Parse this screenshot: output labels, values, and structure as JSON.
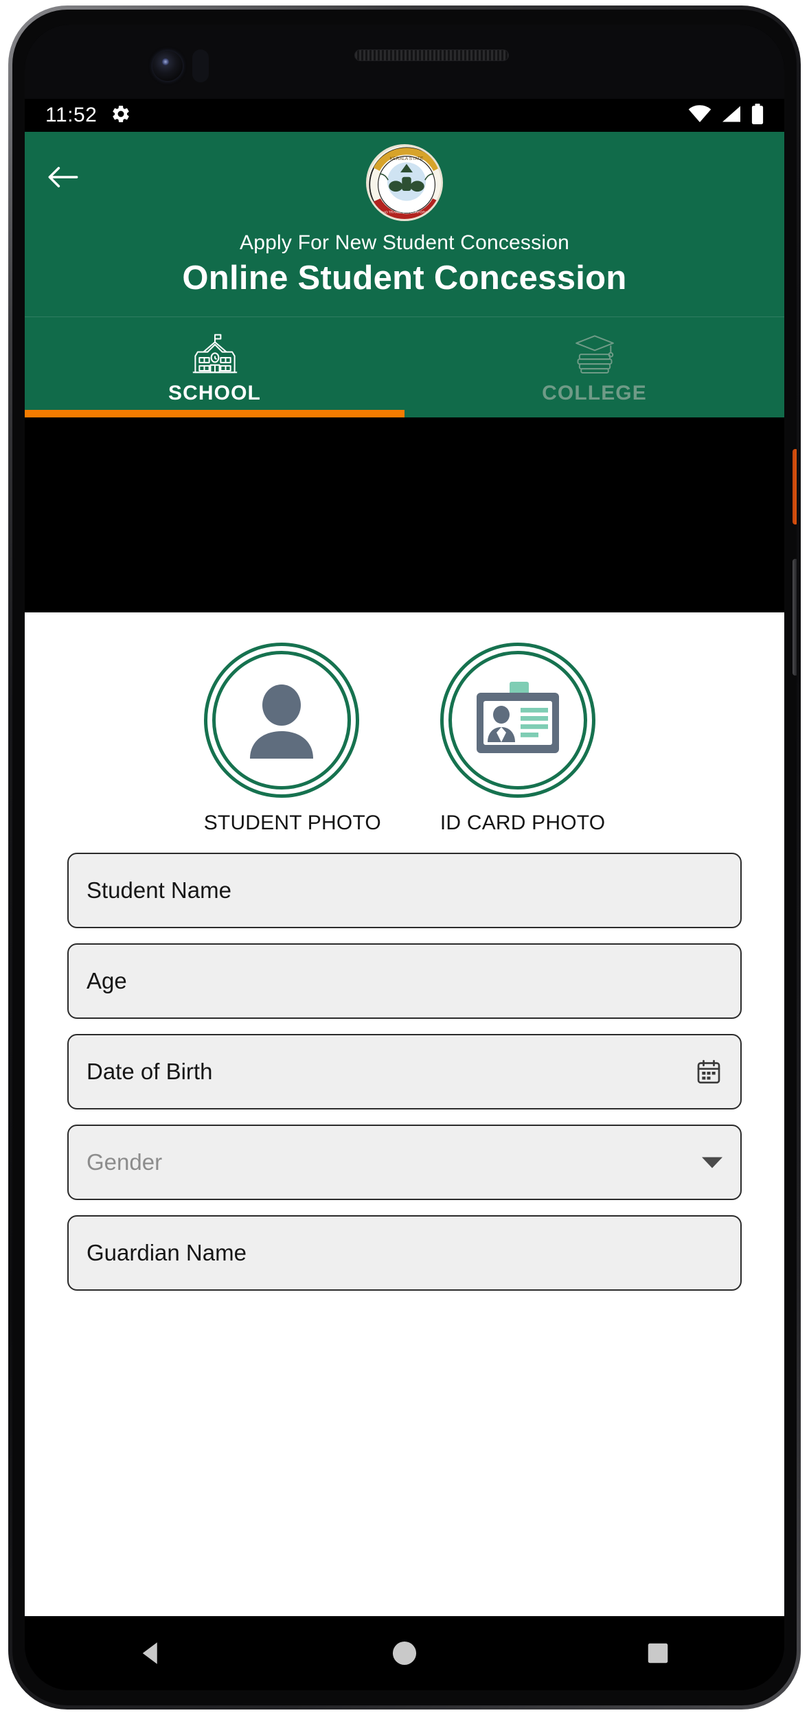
{
  "status_bar": {
    "time": "11:52",
    "icons": [
      "gear-icon",
      "wifi-icon",
      "signal-icon",
      "battery-icon"
    ]
  },
  "header": {
    "back_icon": "arrow-left-icon",
    "logo_alt": "kerala-state-road-transport-corporation-emblem",
    "subtitle": "Apply For New Student Concession",
    "title": "Online Student Concession",
    "background_color": "#116B4A"
  },
  "tabs": {
    "items": [
      {
        "label": "SCHOOL",
        "icon": "school-building-icon",
        "active": true
      },
      {
        "label": "COLLEGE",
        "icon": "graduation-books-icon",
        "active": false
      }
    ],
    "indicator_color": "#F57C00",
    "active_index": 0
  },
  "photos": [
    {
      "caption": "STUDENT PHOTO",
      "icon": "person-avatar-icon"
    },
    {
      "caption": "ID CARD PHOTO",
      "icon": "id-card-icon"
    }
  ],
  "form": {
    "fields": [
      {
        "label": "Student Name",
        "value": "Student Name",
        "is_placeholder": false,
        "icon": null
      },
      {
        "label": "Age",
        "value": "Age",
        "is_placeholder": false,
        "icon": null
      },
      {
        "label": "Date of Birth",
        "value": "Date of Birth",
        "is_placeholder": false,
        "icon": "calendar-icon"
      },
      {
        "label": "Gender",
        "value": "Gender",
        "is_placeholder": true,
        "icon": "chevron-down-icon"
      },
      {
        "label": "Guardian Name",
        "value": "Guardian Name",
        "is_placeholder": false,
        "icon": null
      }
    ],
    "field_bg_color": "#EFEFEF",
    "field_border_color": "#2B2B2B"
  },
  "nav_bar": {
    "back": "triangle-back-icon",
    "home": "circle-home-icon",
    "recents": "square-recents-icon"
  },
  "theme": {
    "primary_green": "#116B4A",
    "ring_green": "#16724F",
    "accent_orange": "#F57C00",
    "avatar_gray": "#5F6D7E"
  }
}
